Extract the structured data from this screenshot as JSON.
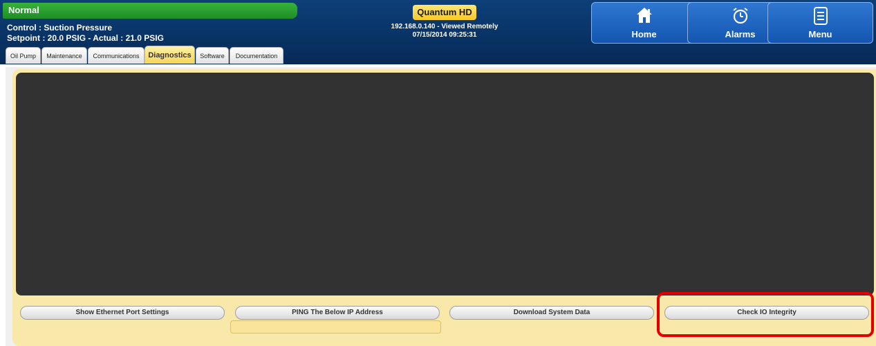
{
  "status": {
    "text": "Normal"
  },
  "control": {
    "line": "Control : Suction Pressure",
    "setpoint_line": "Setpoint : 20.0 PSIG - Actual : 21.0 PSIG"
  },
  "product": {
    "name": "Quantum HD"
  },
  "connection": {
    "remote": "192.168.0.140 - Viewed Remotely",
    "datetime": "07/15/2014 09:25:31"
  },
  "nav": {
    "home": "Home",
    "alarms": "Alarms",
    "menu": "Menu"
  },
  "tabs": [
    "Oil Pump",
    "Maintenance",
    "Communications",
    "Diagnostics",
    "Software",
    "Documentation"
  ],
  "active_tab": "Diagnostics",
  "actions": {
    "ethernet": "Show Ethernet Port Settings",
    "ping": "PING The Below IP Address",
    "download": "Download System Data",
    "check_io": "Check IO Integrity"
  },
  "ping_ip": {
    "value": ""
  },
  "colors": {
    "header": "#0d3f78",
    "status": "#2ea233",
    "panel": "#f8e8a9",
    "screen": "#323232",
    "highlight": "#e50000"
  }
}
